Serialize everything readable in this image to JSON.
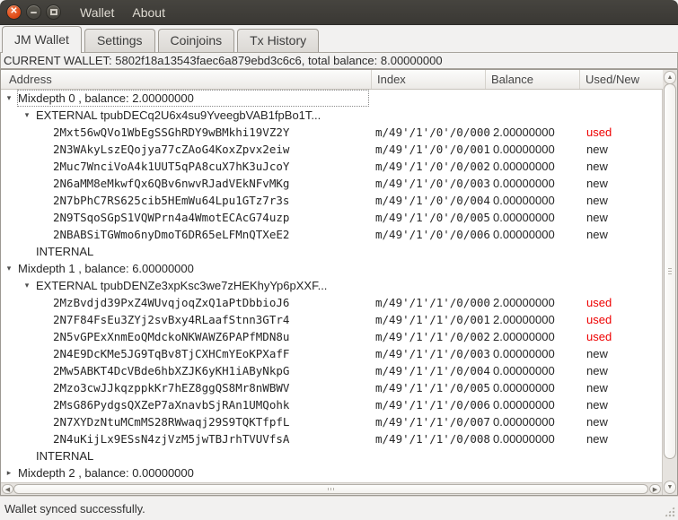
{
  "menubar": {
    "items": [
      "Wallet",
      "About"
    ]
  },
  "tabs": [
    {
      "label": "JM Wallet",
      "active": true
    },
    {
      "label": "Settings",
      "active": false
    },
    {
      "label": "Coinjoins",
      "active": false
    },
    {
      "label": "Tx History",
      "active": false
    }
  ],
  "wallet_banner": "CURRENT WALLET: 5802f18a13543faec6a879ebd3c6c6, total balance: 8.00000000",
  "icons": {
    "close": "✕",
    "tree_expanded": "▾",
    "tree_collapsed": "▸",
    "scroll_up": "▲",
    "scroll_down": "▼",
    "scroll_left": "◀",
    "scroll_right": "▶"
  },
  "colors": {
    "used_status": "#ee0000",
    "close_button": "#df4b16",
    "titlebar": "#3c3b37",
    "window_bg": "#f2f1f0"
  },
  "tree": {
    "columns": [
      "Address",
      "Index",
      "Balance",
      "Used/New"
    ],
    "rows": [
      {
        "depth": 0,
        "arrow": "open",
        "focused": true,
        "label": "Mixdepth 0 , balance: 2.00000000"
      },
      {
        "depth": 1,
        "arrow": "open",
        "label": "EXTERNAL tpubDECq2U6x4su9YveegbVAB1fpBo1T..."
      },
      {
        "depth": 2,
        "mono": true,
        "label": "2Mxt56wQVo1WbEgSSGhRDY9wBMkhi19VZ2Y",
        "index": "m/49'/1'/0'/0/000",
        "balance": "2.00000000",
        "status": "used"
      },
      {
        "depth": 2,
        "mono": true,
        "label": "2N3WAkyLszEQojya77cZAoG4KoxZpvx2eiw",
        "index": "m/49'/1'/0'/0/001",
        "balance": "0.00000000",
        "status": "new"
      },
      {
        "depth": 2,
        "mono": true,
        "label": "2Muc7WnciVoA4k1UUT5qPA8cuX7hK3uJcoY",
        "index": "m/49'/1'/0'/0/002",
        "balance": "0.00000000",
        "status": "new"
      },
      {
        "depth": 2,
        "mono": true,
        "label": "2N6aMM8eMkwfQx6QBv6nwvRJadVEkNFvMKg",
        "index": "m/49'/1'/0'/0/003",
        "balance": "0.00000000",
        "status": "new"
      },
      {
        "depth": 2,
        "mono": true,
        "label": "2N7bPhC7RS625cib5HEmWu64Lpu1GTz7r3s",
        "index": "m/49'/1'/0'/0/004",
        "balance": "0.00000000",
        "status": "new"
      },
      {
        "depth": 2,
        "mono": true,
        "label": "2N9TSqoSGpS1VQWPrn4a4WmotECAcG74uzp",
        "index": "m/49'/1'/0'/0/005",
        "balance": "0.00000000",
        "status": "new"
      },
      {
        "depth": 2,
        "mono": true,
        "label": "2NBABSiTGWmo6nyDmoT6DR65eLFMnQTXeE2",
        "index": "m/49'/1'/0'/0/006",
        "balance": "0.00000000",
        "status": "new"
      },
      {
        "depth": 1,
        "label": "INTERNAL"
      },
      {
        "depth": 0,
        "arrow": "open",
        "label": "Mixdepth 1 , balance: 6.00000000"
      },
      {
        "depth": 1,
        "arrow": "open",
        "label": "EXTERNAL tpubDENZe3xpKsc3we7zHEKhyYp6pXXF..."
      },
      {
        "depth": 2,
        "mono": true,
        "label": "2MzBvdjd39PxZ4WUvqjoqZxQ1aPtDbbioJ6",
        "index": "m/49'/1'/1'/0/000",
        "balance": "2.00000000",
        "status": "used"
      },
      {
        "depth": 2,
        "mono": true,
        "label": "2N7F84FsEu3ZYj2svBxy4RLaafStnn3GTr4",
        "index": "m/49'/1'/1'/0/001",
        "balance": "2.00000000",
        "status": "used"
      },
      {
        "depth": 2,
        "mono": true,
        "label": "2N5vGPExXnmEoQMdckoNKWAWZ6PAPfMDN8u",
        "index": "m/49'/1'/1'/0/002",
        "balance": "2.00000000",
        "status": "used"
      },
      {
        "depth": 2,
        "mono": true,
        "label": "2N4E9DcKMe5JG9TqBv8TjCXHCmYEoKPXafF",
        "index": "m/49'/1'/1'/0/003",
        "balance": "0.00000000",
        "status": "new"
      },
      {
        "depth": 2,
        "mono": true,
        "label": "2Mw5ABKT4DcVBde6hbXZJK6yKH1iAByNkpG",
        "index": "m/49'/1'/1'/0/004",
        "balance": "0.00000000",
        "status": "new"
      },
      {
        "depth": 2,
        "mono": true,
        "label": "2Mzo3cwJJkqzppkKr7hEZ8ggQS8Mr8nWBWV",
        "index": "m/49'/1'/1'/0/005",
        "balance": "0.00000000",
        "status": "new"
      },
      {
        "depth": 2,
        "mono": true,
        "label": "2MsG86PydgsQXZeP7aXnavbSjRAn1UMQohk",
        "index": "m/49'/1'/1'/0/006",
        "balance": "0.00000000",
        "status": "new"
      },
      {
        "depth": 2,
        "mono": true,
        "label": "2N7XYDzNtuMCmMS28RWwaqj29S9TQKTfpfL",
        "index": "m/49'/1'/1'/0/007",
        "balance": "0.00000000",
        "status": "new"
      },
      {
        "depth": 2,
        "mono": true,
        "label": "2N4uKijLx9ESsN4zjVzM5jwTBJrhTVUVfsA",
        "index": "m/49'/1'/1'/0/008",
        "balance": "0.00000000",
        "status": "new"
      },
      {
        "depth": 1,
        "label": "INTERNAL"
      },
      {
        "depth": 0,
        "arrow": "closed",
        "label": "Mixdepth 2 , balance: 0.00000000"
      }
    ]
  },
  "status_bar": {
    "text": "Wallet synced successfully."
  }
}
